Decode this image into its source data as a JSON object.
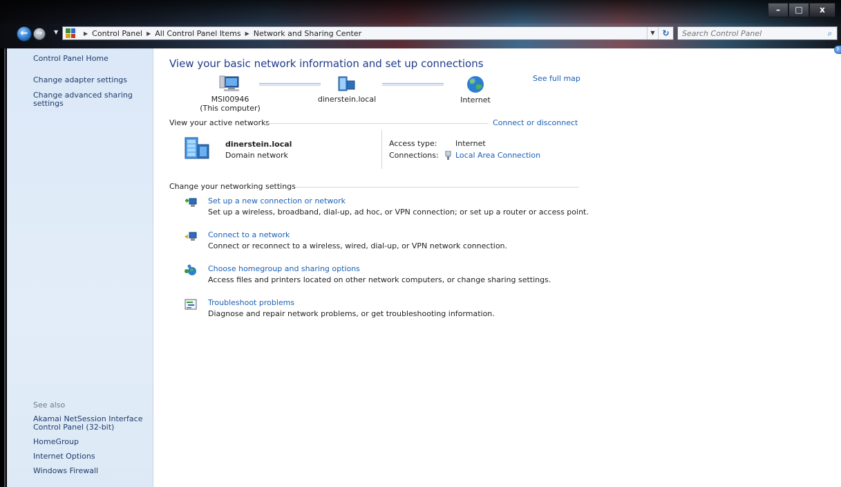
{
  "window": {
    "minimize_label": "–",
    "maximize_label": "□",
    "close_label": "x"
  },
  "nav": {
    "back_glyph": "←",
    "forward_glyph": "→",
    "breadcrumbs": [
      "Control Panel",
      "All Control Panel Items",
      "Network and Sharing Center"
    ],
    "refresh_glyph": "↻",
    "search_placeholder": "Search Control Panel"
  },
  "sidebar": {
    "home": "Control Panel Home",
    "links": [
      "Change adapter settings",
      "Change advanced sharing settings"
    ],
    "see_also_label": "See also",
    "see_also": [
      "Akamai NetSession Interface Control Panel (32-bit)",
      "HomeGroup",
      "Internet Options",
      "Windows Firewall"
    ]
  },
  "main": {
    "title": "View your basic network information and set up connections",
    "see_full_map": "See full map",
    "map": {
      "computer_name": "MSI00946",
      "computer_sub": "(This computer)",
      "network_name": "dinerstein.local",
      "internet": "Internet"
    },
    "active_networks": {
      "heading": "View your active networks",
      "connect_link": "Connect or disconnect",
      "network_name": "dinerstein.local",
      "network_type": "Domain network",
      "access_type_label": "Access type:",
      "access_type_value": "Internet",
      "connections_label": "Connections:",
      "connections_value": "Local Area Connection"
    },
    "settings": {
      "heading": "Change your networking settings",
      "tasks": [
        {
          "title": "Set up a new connection or network",
          "desc": "Set up a wireless, broadband, dial-up, ad hoc, or VPN connection; or set up a router or access point."
        },
        {
          "title": "Connect to a network",
          "desc": "Connect or reconnect to a wireless, wired, dial-up, or VPN network connection."
        },
        {
          "title": "Choose homegroup and sharing options",
          "desc": "Access files and printers located on other network computers, or change sharing settings."
        },
        {
          "title": "Troubleshoot problems",
          "desc": "Diagnose and repair network problems, or get troubleshooting information."
        }
      ]
    }
  },
  "colors": {
    "link": "#1a5fb4",
    "title": "#1e3a8a",
    "sidebar_bg": "#dbe8f7"
  }
}
